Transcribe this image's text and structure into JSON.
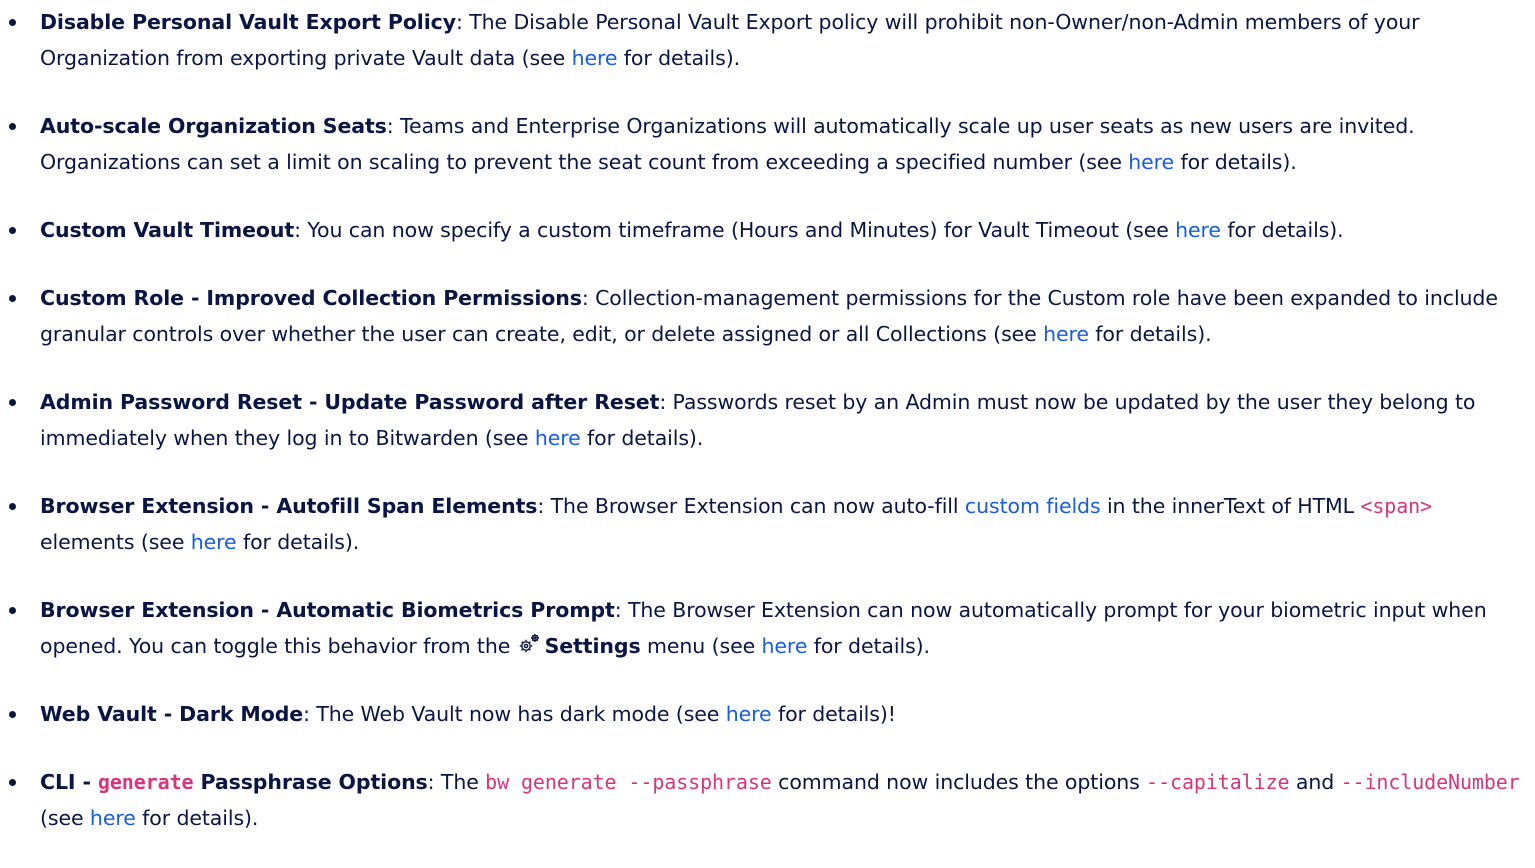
{
  "items": [
    {
      "title": "Disable Personal Vault Export Policy",
      "text": ": The Disable Personal Vault Export policy will prohibit non-Owner/non-Admin members of your Organization from exporting private Vault data (see ",
      "link": "here",
      "end": " for details)."
    },
    {
      "title": "Auto-scale Organization Seats",
      "text": ": Teams and Enterprise Organizations will automatically scale up user seats as new users are invited. Organizations can set a limit on scaling to prevent the seat count from exceeding a specified number (see ",
      "link": "here",
      "end": " for details)."
    },
    {
      "title": "Custom Vault Timeout",
      "text": ": You can now specify a custom timeframe (Hours and Minutes) for Vault Timeout (see ",
      "link": "here",
      "end": " for details)."
    },
    {
      "title": "Custom Role - Improved Collection Permissions",
      "text": ": Collection-management permissions for the Custom role have been expanded to include granular controls over whether the user can create, edit, or delete assigned or all Collections (see ",
      "link": "here",
      "end": " for details)."
    },
    {
      "title": "Admin Password Reset - Update Password after Reset",
      "text": ": Passwords reset by an Admin must now be updated by the user they belong to immediately when they log in to Bitwarden (see ",
      "link": "here",
      "end": " for details)."
    },
    {
      "title": "Browser Extension - Autofill Span Elements",
      "text": ": The Browser Extension can now auto-fill ",
      "link1": "custom fields",
      "mid": " in the innerText of HTML ",
      "code": "<span>",
      "mid2": " elements (see ",
      "link": "here",
      "end": " for details)."
    },
    {
      "title": "Browser Extension - Automatic Biometrics Prompt",
      "text": ": The Browser Extension can now automatically prompt for your biometric input when opened. You can toggle this behavior from the ",
      "icon": "gear-icon",
      "settings": "Settings",
      "mid": " menu (see ",
      "link": "here",
      "end": " for details)."
    },
    {
      "title": "Web Vault - Dark Mode",
      "text": ": The Web Vault now has dark mode (see ",
      "link": "here",
      "end": " for details)!"
    },
    {
      "title_prefix": "CLI - ",
      "title_code": "generate",
      "title_suffix": " Passphrase Options",
      "text": ": The ",
      "code1": "bw generate --passphrase",
      "mid": " command now includes the options ",
      "code2": "--capitalize",
      "mid2": " and ",
      "code3": "--includeNumber",
      "mid3": " (see ",
      "link": "here",
      "end": " for details)."
    }
  ],
  "colors": {
    "text": "#0a1544",
    "link": "#175ddc",
    "code": "#d6357e"
  }
}
